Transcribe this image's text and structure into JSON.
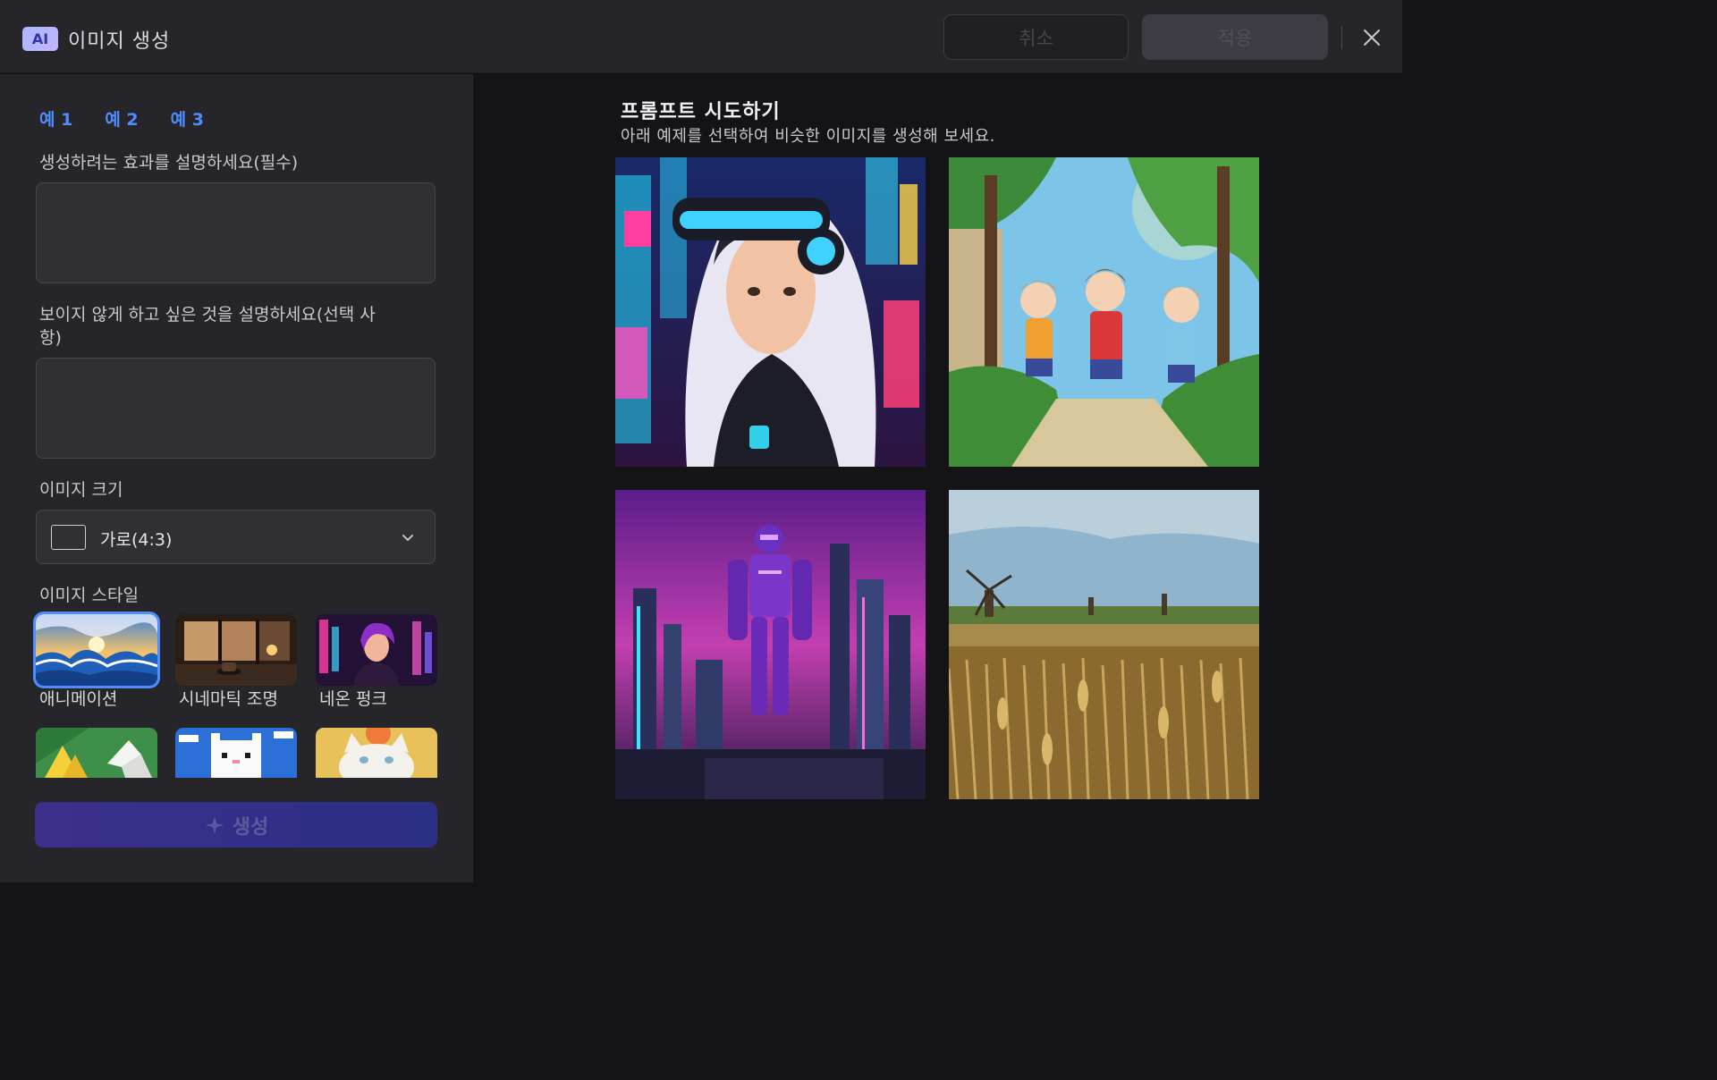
{
  "window": {
    "badge": "AI",
    "title": "이미지 생성",
    "cancel_label": "취소",
    "apply_label": "적용"
  },
  "left": {
    "example_tabs": [
      "예 1",
      "예 2",
      "예 3"
    ],
    "prompt_label": "생성하려는 효과를 설명하세요(필수)",
    "prompt_value": "",
    "negative_label_line1": "보이지 않게 하고 싶은 것을 설명하세요(선택 사",
    "negative_label_line2": "항)",
    "negative_value": "",
    "size_label": "이미지 크기",
    "size_value": "가로(4:3)",
    "style_label": "이미지 스타일",
    "styles": [
      {
        "label": "애니메이션",
        "selected": true
      },
      {
        "label": "시네마틱 조명",
        "selected": false
      },
      {
        "label": "네온 펑크",
        "selected": false
      }
    ],
    "generate_label": "생성"
  },
  "right": {
    "title": "프롬프트 시도하기",
    "subtitle": "아래 예제를 선택하여 비슷한 이미지를 생성해 보세요."
  },
  "colors": {
    "accent": "#4f8dff",
    "panel": "#26262a",
    "background": "#141417"
  }
}
